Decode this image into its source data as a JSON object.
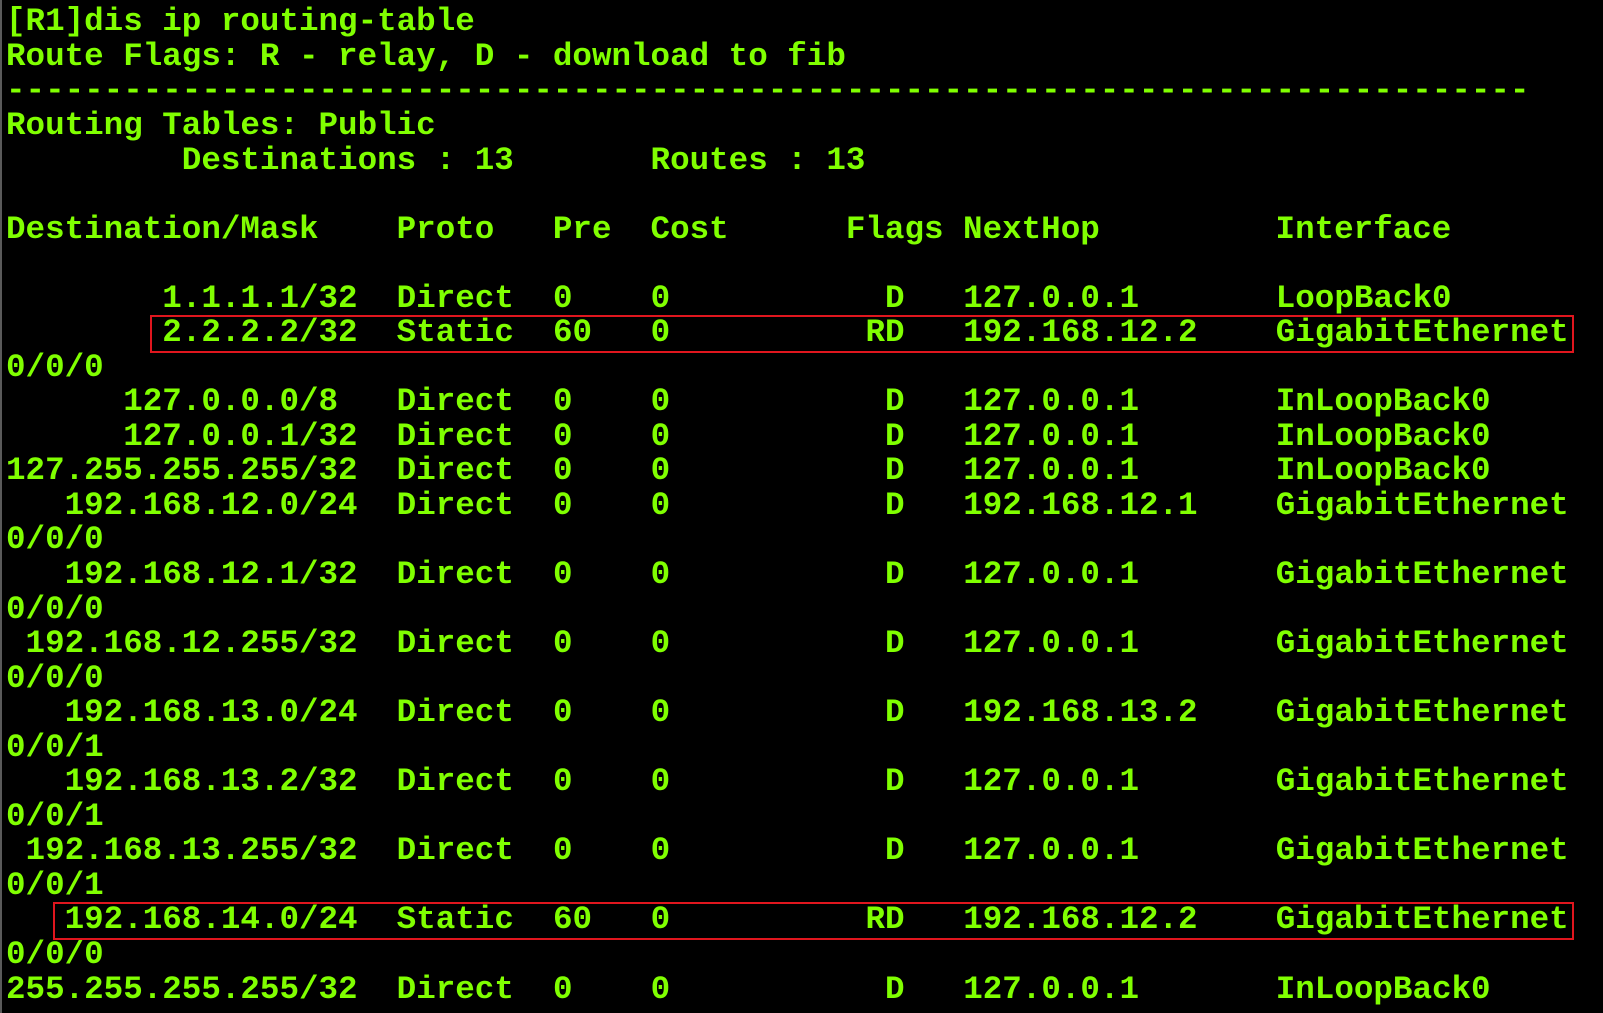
{
  "theme": {
    "background": "#000000",
    "text_color": "#80ff00",
    "highlight_color": "#e0161e"
  },
  "session": {
    "prompt": "[R1]",
    "command": "dis ip routing-table"
  },
  "output": {
    "route_flags_legend": "Route Flags: R - relay, D - download to fib",
    "separator": "------------------------------------------------------------------------------",
    "routing_tables_label": "Routing Tables:",
    "routing_table_name": "Public",
    "destinations_label": "Destinations :",
    "destinations_count": 13,
    "routes_label": "Routes :",
    "routes_count": 13,
    "columns": [
      "Destination/Mask",
      "Proto",
      "Pre",
      "Cost",
      "Flags",
      "NextHop",
      "Interface"
    ],
    "routes": [
      {
        "destination": "1.1.1.1/32",
        "proto": "Direct",
        "pre": 0,
        "cost": 0,
        "flags": "D",
        "nexthop": "127.0.0.1",
        "interface": "LoopBack0"
      },
      {
        "destination": "2.2.2.2/32",
        "proto": "Static",
        "pre": 60,
        "cost": 0,
        "flags": "RD",
        "nexthop": "192.168.12.2",
        "interface": "GigabitEthernet0/0/0",
        "highlighted": true
      },
      {
        "destination": "127.0.0.0/8",
        "proto": "Direct",
        "pre": 0,
        "cost": 0,
        "flags": "D",
        "nexthop": "127.0.0.1",
        "interface": "InLoopBack0"
      },
      {
        "destination": "127.0.0.1/32",
        "proto": "Direct",
        "pre": 0,
        "cost": 0,
        "flags": "D",
        "nexthop": "127.0.0.1",
        "interface": "InLoopBack0"
      },
      {
        "destination": "127.255.255.255/32",
        "proto": "Direct",
        "pre": 0,
        "cost": 0,
        "flags": "D",
        "nexthop": "127.0.0.1",
        "interface": "InLoopBack0"
      },
      {
        "destination": "192.168.12.0/24",
        "proto": "Direct",
        "pre": 0,
        "cost": 0,
        "flags": "D",
        "nexthop": "192.168.12.1",
        "interface": "GigabitEthernet0/0/0"
      },
      {
        "destination": "192.168.12.1/32",
        "proto": "Direct",
        "pre": 0,
        "cost": 0,
        "flags": "D",
        "nexthop": "127.0.0.1",
        "interface": "GigabitEthernet0/0/0"
      },
      {
        "destination": "192.168.12.255/32",
        "proto": "Direct",
        "pre": 0,
        "cost": 0,
        "flags": "D",
        "nexthop": "127.0.0.1",
        "interface": "GigabitEthernet0/0/0"
      },
      {
        "destination": "192.168.13.0/24",
        "proto": "Direct",
        "pre": 0,
        "cost": 0,
        "flags": "D",
        "nexthop": "192.168.13.2",
        "interface": "GigabitEthernet0/0/1"
      },
      {
        "destination": "192.168.13.2/32",
        "proto": "Direct",
        "pre": 0,
        "cost": 0,
        "flags": "D",
        "nexthop": "127.0.0.1",
        "interface": "GigabitEthernet0/0/1"
      },
      {
        "destination": "192.168.13.255/32",
        "proto": "Direct",
        "pre": 0,
        "cost": 0,
        "flags": "D",
        "nexthop": "127.0.0.1",
        "interface": "GigabitEthernet0/0/1"
      },
      {
        "destination": "192.168.14.0/24",
        "proto": "Static",
        "pre": 60,
        "cost": 0,
        "flags": "RD",
        "nexthop": "192.168.12.2",
        "interface": "GigabitEthernet0/0/0",
        "highlighted": true
      },
      {
        "destination": "255.255.255.255/32",
        "proto": "Direct",
        "pre": 0,
        "cost": 0,
        "flags": "D",
        "nexthop": "127.0.0.1",
        "interface": "InLoopBack0"
      }
    ]
  }
}
